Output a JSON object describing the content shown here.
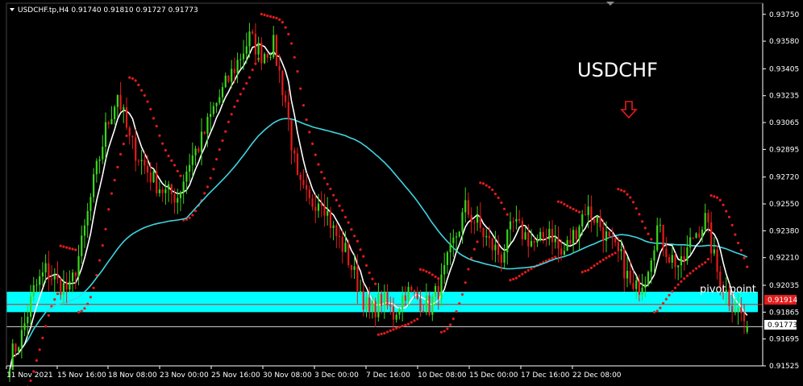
{
  "header": {
    "symbol_line": "USDCHF.tp,H4  0.91740 0.91810 0.91727 0.91773"
  },
  "chart_data": {
    "type": "candlestick",
    "symbol": "USDCHF.tp",
    "timeframe": "H4",
    "ohlc_last": {
      "open": 0.9174,
      "high": 0.9181,
      "low": 0.91727,
      "close": 0.91773
    },
    "annotation_title": "USDCHF",
    "annotation_arrow": "down-arrow-icon",
    "pivot_label": "pivot point",
    "pivot_zone": [
      0.91865,
      0.91994
    ],
    "price_marker_red": "0.91914",
    "price_marker_current": "0.91773",
    "ylim": [
      0.91525,
      0.9381
    ],
    "y_ticks": [
      "0.93750",
      "0.93580",
      "0.93405",
      "0.93235",
      "0.93065",
      "0.92895",
      "0.92720",
      "0.92550",
      "0.92380",
      "0.92210",
      "0.92035",
      "0.91865",
      "0.91695",
      "0.91525"
    ],
    "x_ticks": [
      "11 Nov 2021",
      "15 Nov 16:00",
      "18 Nov 08:00",
      "23 Nov 00:00",
      "25 Nov 16:00",
      "30 Nov 08:00",
      "3 Dec 00:00",
      "7 Dec 16:00",
      "10 Dec 08:00",
      "15 Dec 00:00",
      "17 Dec 16:00",
      "22 Dec 08:00"
    ],
    "price_path": [
      [
        0,
        0.9157
      ],
      [
        4,
        0.9172
      ],
      [
        8,
        0.92
      ],
      [
        12,
        0.9213
      ],
      [
        16,
        0.9205
      ],
      [
        20,
        0.92
      ],
      [
        24,
        0.9229
      ],
      [
        28,
        0.9268
      ],
      [
        32,
        0.9302
      ],
      [
        36,
        0.9325
      ],
      [
        40,
        0.9295
      ],
      [
        44,
        0.9282
      ],
      [
        48,
        0.927
      ],
      [
        52,
        0.9262
      ],
      [
        56,
        0.926
      ],
      [
        60,
        0.9282
      ],
      [
        64,
        0.9295
      ],
      [
        68,
        0.9315
      ],
      [
        72,
        0.933
      ],
      [
        76,
        0.9345
      ],
      [
        80,
        0.936
      ],
      [
        84,
        0.935
      ],
      [
        88,
        0.9355
      ],
      [
        92,
        0.932
      ],
      [
        96,
        0.9268
      ],
      [
        100,
        0.9255
      ],
      [
        104,
        0.926
      ],
      [
        108,
        0.9238
      ],
      [
        112,
        0.9225
      ],
      [
        116,
        0.9205
      ],
      [
        120,
        0.9185
      ],
      [
        124,
        0.9195
      ],
      [
        128,
        0.9185
      ],
      [
        132,
        0.92
      ],
      [
        136,
        0.9195
      ],
      [
        140,
        0.919
      ],
      [
        144,
        0.9205
      ],
      [
        148,
        0.923
      ],
      [
        152,
        0.9252
      ],
      [
        156,
        0.9242
      ],
      [
        160,
        0.923
      ],
      [
        164,
        0.9222
      ],
      [
        168,
        0.9242
      ],
      [
        172,
        0.9235
      ],
      [
        176,
        0.9228
      ],
      [
        180,
        0.924
      ],
      [
        184,
        0.9222
      ],
      [
        188,
        0.9235
      ],
      [
        192,
        0.9252
      ],
      [
        196,
        0.9245
      ],
      [
        200,
        0.923
      ],
      [
        204,
        0.922
      ],
      [
        208,
        0.9198
      ],
      [
        212,
        0.921
      ],
      [
        216,
        0.924
      ],
      [
        220,
        0.9222
      ],
      [
        224,
        0.9215
      ],
      [
        228,
        0.9235
      ],
      [
        232,
        0.9245
      ],
      [
        236,
        0.9212
      ],
      [
        240,
        0.9195
      ],
      [
        244,
        0.9185
      ],
      [
        246,
        0.9177
      ]
    ],
    "series": [
      {
        "color": "#ffffff"
      },
      {
        "color": "#40d4e0"
      },
      {
        "color": "#e31b1b"
      }
    ],
    "colors": {
      "bull": "#3bd61d",
      "bear": "#e31b1b",
      "background": "#000000",
      "axis": "#ffffff",
      "pivot": "#00ffff"
    }
  }
}
